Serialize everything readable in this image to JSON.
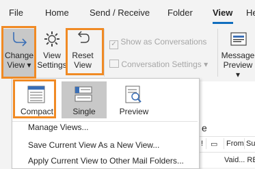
{
  "tabs": [
    {
      "label": "File",
      "active": false
    },
    {
      "label": "Home",
      "active": false
    },
    {
      "label": "Send / Receive",
      "active": false
    },
    {
      "label": "Folder",
      "active": false
    },
    {
      "label": "View",
      "active": true
    },
    {
      "label": "He",
      "active": false
    }
  ],
  "ribbon": {
    "change_view": {
      "line1": "Change",
      "line2": "View ▾"
    },
    "view_settings": {
      "line1": "View",
      "line2": "Settings"
    },
    "reset_view": {
      "line1": "Reset",
      "line2": "View"
    },
    "show_as_conversations": {
      "label": "Show as Conversations",
      "checked": true,
      "enabled": false
    },
    "conversation_settings": {
      "label": "Conversation Settings ▾",
      "enabled": false
    },
    "message_preview": {
      "line1": "Message",
      "line2": "Preview ▾"
    }
  },
  "dropdown": {
    "view_options": [
      {
        "label": "Compact",
        "selected": false
      },
      {
        "label": "Single",
        "selected": true
      },
      {
        "label": "Preview",
        "selected": false
      }
    ],
    "menu_items": [
      {
        "label": "Manage Views..."
      },
      {
        "label": "Save Current View As a New View..."
      },
      {
        "label": "Apply Current View to Other Mail Folders..."
      }
    ]
  },
  "message_list": {
    "column_frag": "e",
    "col_icons": "!",
    "col_from": "From",
    "col_sub": "Su",
    "row_text": "Vaid... RE"
  },
  "colors": {
    "accent": "#106ebe",
    "highlight": "#f08a24",
    "selected_bg": "#c8c8c8"
  }
}
